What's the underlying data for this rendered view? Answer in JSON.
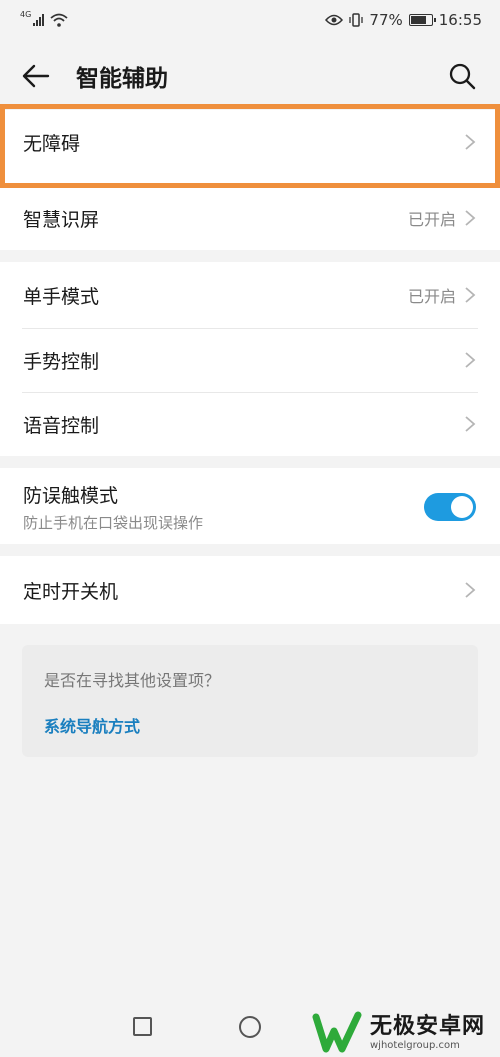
{
  "status_bar": {
    "network": "4G",
    "battery_pct": "77%",
    "battery_fill": 0.77,
    "time": "16:55"
  },
  "header": {
    "title": "智能辅助",
    "back_icon": "arrow-left-icon",
    "search_icon": "search-icon"
  },
  "section1": [
    {
      "label": "无障碍",
      "status": ""
    },
    {
      "label": "智慧识屏",
      "status": "已开启"
    }
  ],
  "section2": [
    {
      "label": "单手模式",
      "status": "已开启"
    },
    {
      "label": "手势控制",
      "status": ""
    },
    {
      "label": "语音控制",
      "status": ""
    }
  ],
  "section3": {
    "label": "防误触模式",
    "sublabel": "防止手机在口袋出现误操作",
    "toggle_on": true
  },
  "section4": {
    "label": "定时开关机"
  },
  "suggestion": {
    "question": "是否在寻找其他设置项？",
    "link": "系统导航方式"
  },
  "watermark": {
    "name": "无极安卓网",
    "url": "wjhotelgroup.com"
  },
  "colors": {
    "accent": "#1e9be0",
    "highlight": "#ef8f3c",
    "link": "#1a7fbf"
  }
}
